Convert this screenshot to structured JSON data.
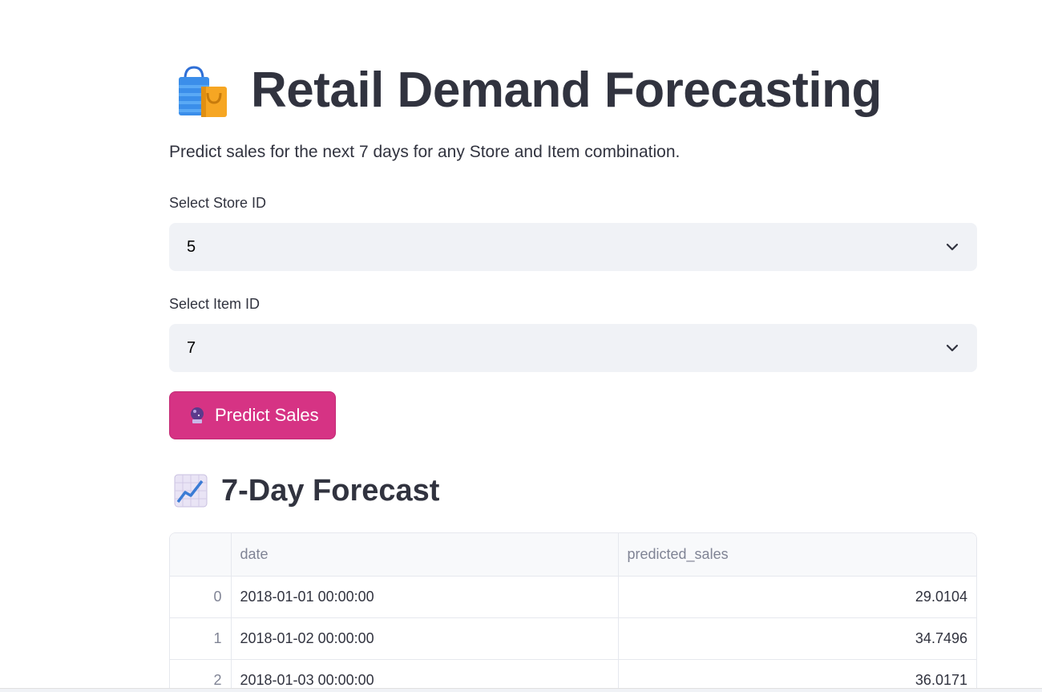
{
  "header": {
    "title": "Retail Demand Forecasting",
    "title_icon": "shopping-bags-icon",
    "subtitle": "Predict sales for the next 7 days for any Store and Item combination."
  },
  "form": {
    "store": {
      "label": "Select Store ID",
      "value": "5"
    },
    "item": {
      "label": "Select Item ID",
      "value": "7"
    },
    "predict_button": {
      "label": "Predict Sales",
      "icon": "crystal-ball-icon",
      "color": "#d63384"
    }
  },
  "forecast": {
    "title": "7-Day Forecast",
    "title_icon": "chart-increasing-icon",
    "columns": [
      "",
      "date",
      "predicted_sales"
    ],
    "rows": [
      {
        "index": "0",
        "date": "2018-01-01 00:00:00",
        "predicted_sales": "29.0104"
      },
      {
        "index": "1",
        "date": "2018-01-02 00:00:00",
        "predicted_sales": "34.7496"
      },
      {
        "index": "2",
        "date": "2018-01-03 00:00:00",
        "predicted_sales": "36.0171"
      }
    ]
  }
}
